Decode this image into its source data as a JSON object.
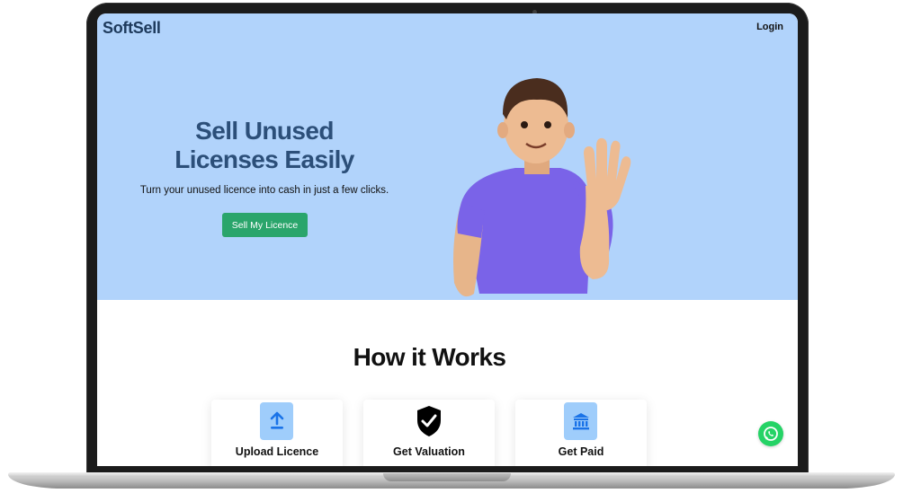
{
  "header": {
    "brand": "SoftSell",
    "login_label": "Login"
  },
  "hero": {
    "title_line1": "Sell Unused",
    "title_line2": "Licenses Easily",
    "subtitle": "Turn your unused licence into cash in just a few clicks.",
    "cta_label": "Sell My Licence",
    "background": "#b1d3fb",
    "title_color": "#2c4f79",
    "cta_color": "#2aa56b"
  },
  "how_it_works": {
    "title": "How it Works",
    "steps": [
      {
        "label": "Upload Licence",
        "icon": "upload-icon"
      },
      {
        "label": "Get Valuation",
        "icon": "shield-check-icon"
      },
      {
        "label": "Get Paid",
        "icon": "bank-icon"
      }
    ]
  },
  "chat": {
    "icon": "whatsapp-icon",
    "color": "#25d366"
  }
}
